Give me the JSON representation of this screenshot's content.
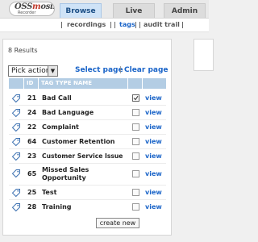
{
  "header": {
    "logo_main": "OSSmosis",
    "logo_accent": "m",
    "logo_sub": "Recorder",
    "nav": [
      {
        "label": "Browse",
        "active": true
      },
      {
        "label": "Live",
        "active": false
      },
      {
        "label": "Admin",
        "active": false
      }
    ]
  },
  "submenu": {
    "pipe": "|",
    "recordings": "recordings",
    "tags": "tags",
    "audit": "audit trail"
  },
  "results": "8 Results",
  "pick_action": "Pick action",
  "select_page": "Select page",
  "clear_page": "Clear page",
  "separator": "|",
  "table": {
    "columns": [
      "ID",
      "TAG TYPE NAME"
    ],
    "rows": [
      {
        "id": "21",
        "name": "Bad Call",
        "checked": true,
        "view": "view"
      },
      {
        "id": "24",
        "name": "Bad Language",
        "checked": false,
        "view": "view"
      },
      {
        "id": "22",
        "name": "Complaint",
        "checked": false,
        "view": "view"
      },
      {
        "id": "64",
        "name": "Customer Retention",
        "checked": false,
        "view": "view"
      },
      {
        "id": "23",
        "name": "Customer Service Issue",
        "checked": false,
        "view": "view"
      },
      {
        "id": "65",
        "name": "Missed Sales Opportunity",
        "checked": false,
        "view": "view"
      },
      {
        "id": "25",
        "name": "Test",
        "checked": false,
        "view": "view"
      },
      {
        "id": "28",
        "name": "Training",
        "checked": false,
        "view": "view"
      }
    ]
  },
  "create_button": "create new",
  "colors": {
    "link": "#1a64c8",
    "header_bg": "#b3cde4",
    "active_tab": "#cfe3f7"
  }
}
